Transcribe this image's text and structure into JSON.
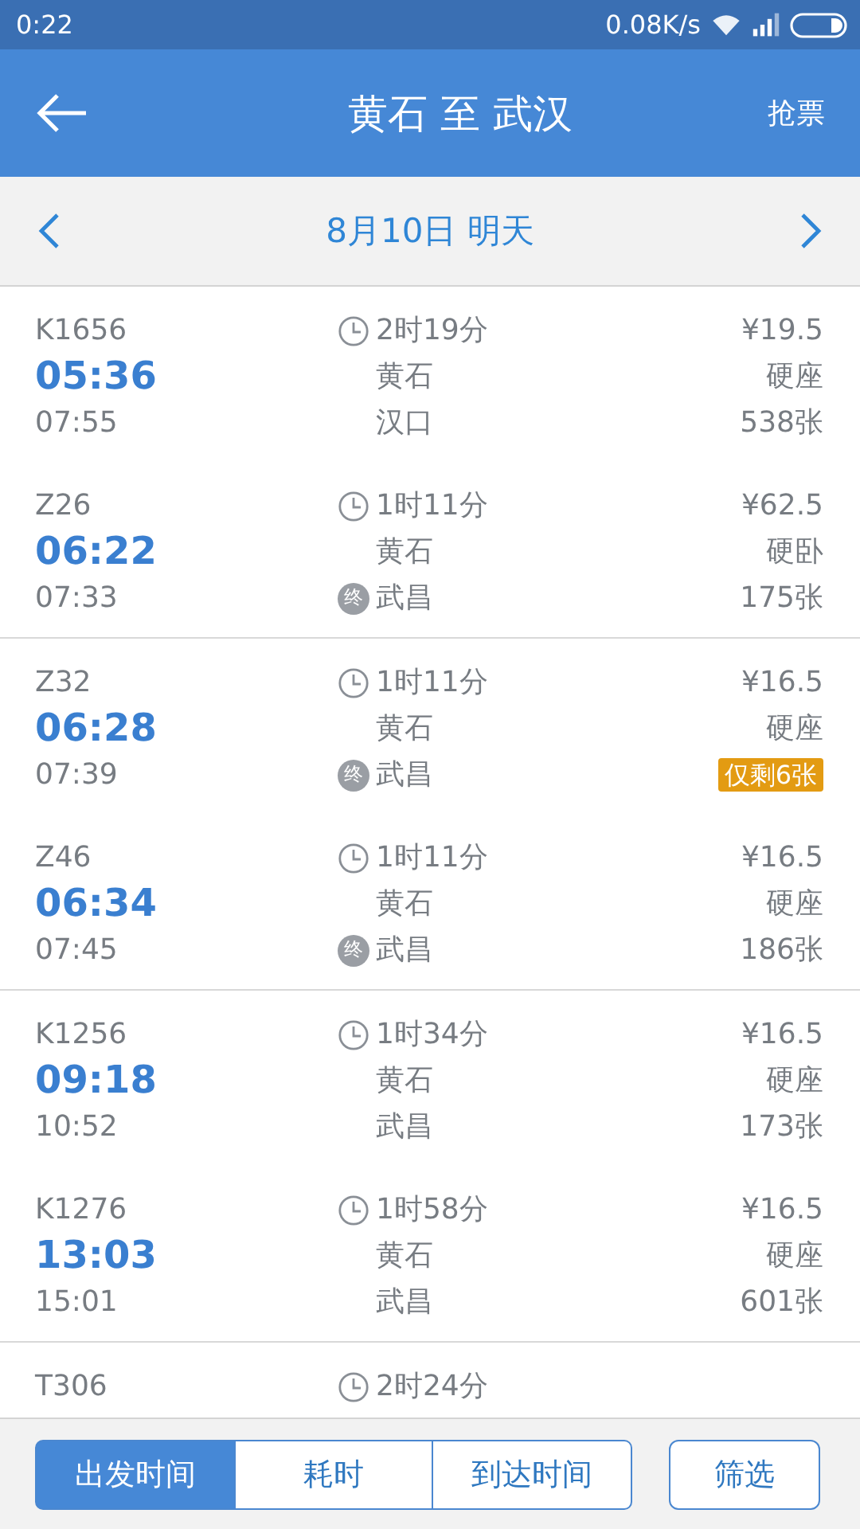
{
  "status_bar": {
    "time": "0:22",
    "speed": "0.08K/s"
  },
  "header": {
    "title": "黄石 至 武汉",
    "action": "抢票"
  },
  "date_bar": {
    "date": "8月10日 明天"
  },
  "groups": [
    {
      "trains": [
        {
          "train": "K1656",
          "depart": "05:36",
          "arrive": "07:55",
          "duration": "2时19分",
          "from": "黄石",
          "to": "汉口",
          "terminal": false,
          "price": "¥19.5",
          "seat": "硬座",
          "tickets": "538张",
          "low": false
        },
        {
          "train": "Z26",
          "depart": "06:22",
          "arrive": "07:33",
          "duration": "1时11分",
          "from": "黄石",
          "to": "武昌",
          "terminal": true,
          "terminal_mark": "终",
          "price": "¥62.5",
          "seat": "硬卧",
          "tickets": "175张",
          "low": false
        }
      ]
    },
    {
      "trains": [
        {
          "train": "Z32",
          "depart": "06:28",
          "arrive": "07:39",
          "duration": "1时11分",
          "from": "黄石",
          "to": "武昌",
          "terminal": true,
          "terminal_mark": "终",
          "price": "¥16.5",
          "seat": "硬座",
          "tickets": "仅剩6张",
          "low": true
        },
        {
          "train": "Z46",
          "depart": "06:34",
          "arrive": "07:45",
          "duration": "1时11分",
          "from": "黄石",
          "to": "武昌",
          "terminal": true,
          "terminal_mark": "终",
          "price": "¥16.5",
          "seat": "硬座",
          "tickets": "186张",
          "low": false
        }
      ]
    },
    {
      "trains": [
        {
          "train": "K1256",
          "depart": "09:18",
          "arrive": "10:52",
          "duration": "1时34分",
          "from": "黄石",
          "to": "武昌",
          "terminal": false,
          "price": "¥16.5",
          "seat": "硬座",
          "tickets": "173张",
          "low": false
        },
        {
          "train": "K1276",
          "depart": "13:03",
          "arrive": "15:01",
          "duration": "1时58分",
          "from": "黄石",
          "to": "武昌",
          "terminal": false,
          "price": "¥16.5",
          "seat": "硬座",
          "tickets": "601张",
          "low": false
        }
      ]
    },
    {
      "trains": [
        {
          "train": "T306",
          "duration": "2时24分"
        }
      ]
    }
  ],
  "sort_tabs": [
    {
      "label": "出发时间",
      "selected": true
    },
    {
      "label": "耗时",
      "selected": false
    },
    {
      "label": "到达时间",
      "selected": false
    }
  ],
  "filter_button": "筛选"
}
